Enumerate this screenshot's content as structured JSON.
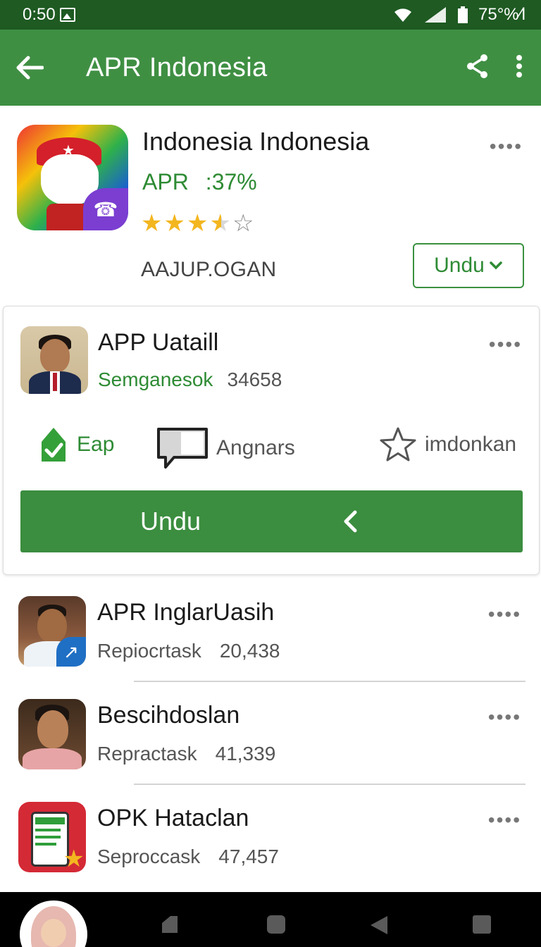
{
  "status_bar": {
    "time": "0:50",
    "battery": "75°%⁄l"
  },
  "app_bar": {
    "title": "APR Indonesia"
  },
  "header": {
    "title": "Indonesia Indonesia",
    "apr_label": "APR",
    "apr_value": ":37%",
    "rating": 3.5,
    "developer": "AAJUP.OGAN",
    "button_label": "Undu",
    "more": "••••"
  },
  "detail": {
    "title": "APP Uataill",
    "subtitle_green": "Semganesok",
    "subtitle_count": "34658",
    "more": "••••",
    "actions": [
      {
        "label": "Eap",
        "icon": "check-badge-icon"
      },
      {
        "label": "Angnars",
        "icon": "comment-icon"
      },
      {
        "label": "imdonkan",
        "icon": "star-outline-icon"
      }
    ],
    "button_label": "Undu"
  },
  "list": [
    {
      "title": "APR InglarUasih",
      "subtitle": "Repiocrtask",
      "count": "20,438",
      "more": "••••"
    },
    {
      "title": "Bescihdoslan",
      "subtitle": "Repractask",
      "count": "41,339",
      "more": "••••"
    },
    {
      "title": "OPK Hataclan",
      "subtitle": "Seproccask",
      "count": "47,457",
      "more": "••••"
    }
  ],
  "colors": {
    "primary": "#3f8f43",
    "status_bar": "#1e5a22",
    "accent_green": "#2e8b34",
    "star": "#f3b61f"
  }
}
